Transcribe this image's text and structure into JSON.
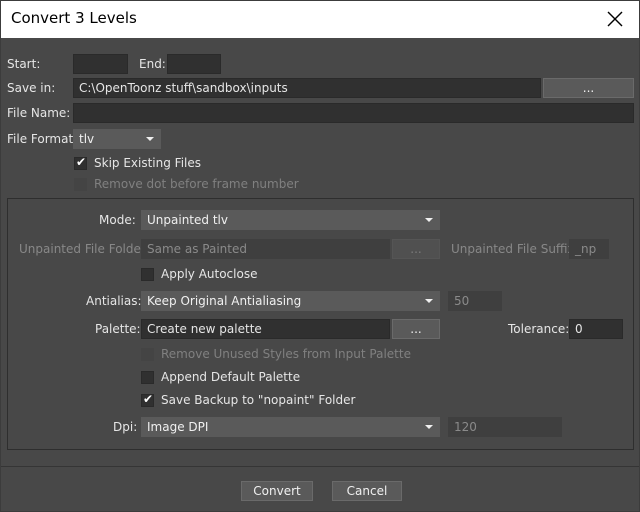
{
  "window": {
    "title": "Convert 3 Levels"
  },
  "icons": {
    "close": "close-icon",
    "checkmark": "checkmark-icon",
    "dropdown": "chevron-down-icon"
  },
  "top": {
    "start_label": "Start:",
    "start_value": "",
    "end_label": "End:",
    "end_value": "",
    "save_in_label": "Save in:",
    "save_in_value": "C:\\OpenToonz stuff\\sandbox\\inputs",
    "browse_label": "...",
    "file_name_label": "File Name:",
    "file_name_value": "",
    "file_format_label": "File Format:",
    "file_format_value": "tlv",
    "skip_existing_label": "Skip Existing Files",
    "skip_existing_checked": true,
    "remove_dot_label": "Remove dot before frame number",
    "remove_dot_checked": false
  },
  "settings": {
    "mode_label": "Mode:",
    "mode_value": "Unpainted tlv",
    "unpainted_folder_label": "Unpainted File Folder:",
    "unpainted_folder_value": "Same as Painted",
    "unpainted_browse_label": "...",
    "unpainted_suffix_label": "Unpainted File Suffix:",
    "unpainted_suffix_value": "_np",
    "apply_autoclose_label": "Apply Autoclose",
    "apply_autoclose_checked": false,
    "antialias_label": "Antialias:",
    "antialias_value": "Keep Original Antialiasing",
    "antialias_amount": "50",
    "palette_label": "Palette:",
    "palette_value": "Create new palette",
    "palette_browse_label": "...",
    "tolerance_label": "Tolerance:",
    "tolerance_value": "0",
    "remove_unused_label": "Remove Unused Styles from Input Palette",
    "remove_unused_checked": false,
    "append_default_label": "Append Default Palette",
    "append_default_checked": false,
    "save_backup_label": "Save Backup to \"nopaint\" Folder",
    "save_backup_checked": true,
    "dpi_label": "Dpi:",
    "dpi_value": "Image DPI",
    "dpi_amount": "120"
  },
  "footer": {
    "convert_label": "Convert",
    "cancel_label": "Cancel"
  }
}
